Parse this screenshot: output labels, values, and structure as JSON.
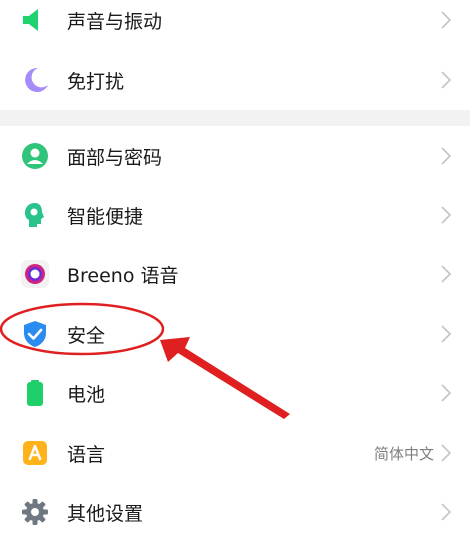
{
  "settings": {
    "group1": [
      {
        "label": "声音与振动",
        "icon": "speaker-icon"
      },
      {
        "label": "免打扰",
        "icon": "moon-icon"
      }
    ],
    "group2": [
      {
        "label": "面部与密码",
        "icon": "face-lock-icon"
      },
      {
        "label": "智能便捷",
        "icon": "smart-assist-icon"
      },
      {
        "label": "Breeno 语音",
        "icon": "breeno-icon"
      },
      {
        "label": "安全",
        "icon": "shield-icon"
      },
      {
        "label": "电池",
        "icon": "battery-icon"
      },
      {
        "label": "语言",
        "icon": "language-icon",
        "value": "简体中文"
      },
      {
        "label": "其他设置",
        "icon": "gear-icon"
      }
    ]
  },
  "colors": {
    "accent_green": "#1ed26f",
    "moon_purple": "#a78bfa",
    "annotation_red": "#e02020"
  }
}
